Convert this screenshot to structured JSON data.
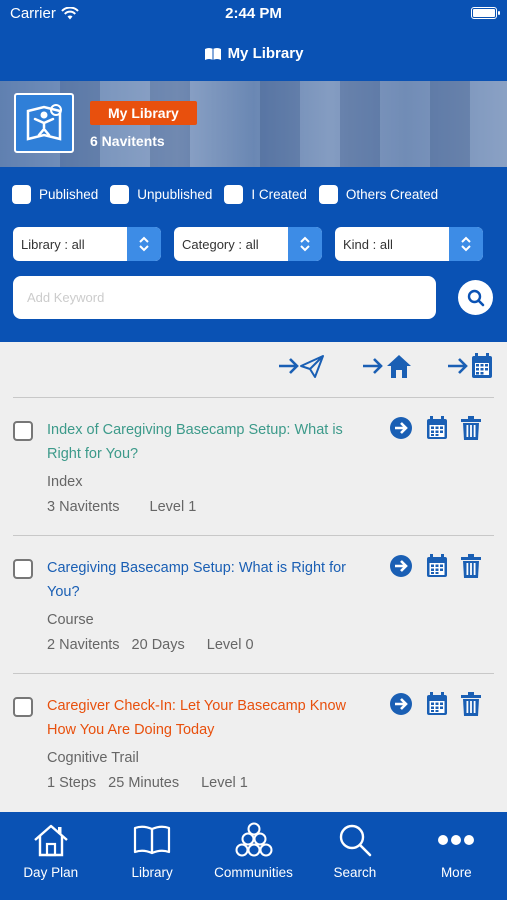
{
  "status_bar": {
    "carrier": "Carrier",
    "time": "2:44 PM"
  },
  "navbar": {
    "title": "My Library"
  },
  "banner": {
    "badge": "My Library",
    "count": "6 Navitents"
  },
  "filters": {
    "checkboxes": [
      "Published",
      "Unpublished",
      "I Created",
      "Others Created"
    ],
    "selects": [
      "Library : all",
      "Category : all",
      "Kind : all"
    ],
    "keyword_placeholder": "Add Keyword"
  },
  "items": [
    {
      "title": "Index of Caregiving Basecamp Setup: What is Right for You?",
      "kind": "Index",
      "meta": [
        "3 Navitents",
        "Level 1"
      ],
      "color": "#3c9a8a"
    },
    {
      "title": "Caregiving Basecamp Setup: What is Right for You?",
      "kind": "Course",
      "meta": [
        "2 Navitents",
        "20 Days",
        "Level 0"
      ],
      "color": "#1a5fb4"
    },
    {
      "title": "Caregiver Check-In: Let Your Basecamp Know How You Are Doing Today",
      "kind": "Cognitive Trail",
      "meta": [
        "1 Steps",
        "25 Minutes",
        "Level 1"
      ],
      "color": "#e8500d"
    }
  ],
  "tabs": [
    {
      "label": "Day Plan",
      "icon": "house-icon"
    },
    {
      "label": "Library",
      "icon": "book-icon"
    },
    {
      "label": "Communities",
      "icon": "communities-icon"
    },
    {
      "label": "Search",
      "icon": "search-icon"
    },
    {
      "label": "More",
      "icon": "more-icon"
    }
  ],
  "colors": {
    "primary": "#0a52b4",
    "accent": "#e8500d",
    "link_blue": "#1a5fb4",
    "teal": "#3c9a8a"
  }
}
